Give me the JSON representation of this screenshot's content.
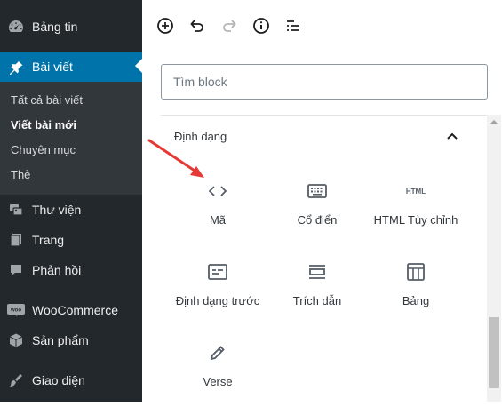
{
  "sidebar": {
    "items": [
      {
        "label": "Bảng tin",
        "icon": "dashboard-icon"
      },
      {
        "label": "Bài viết",
        "icon": "pushpin-icon"
      },
      {
        "label": "Thư viện",
        "icon": "media-icon"
      },
      {
        "label": "Trang",
        "icon": "pages-icon"
      },
      {
        "label": "Phản hồi",
        "icon": "comments-icon"
      },
      {
        "label": "WooCommerce",
        "icon": "woocommerce-icon"
      },
      {
        "label": "Sản phẩm",
        "icon": "products-icon"
      },
      {
        "label": "Giao diện",
        "icon": "appearance-icon"
      }
    ],
    "submenu": [
      {
        "label": "Tất cả bài viết"
      },
      {
        "label": "Viết bài mới"
      },
      {
        "label": "Chuyên mục"
      },
      {
        "label": "Thẻ"
      }
    ],
    "woo_badge": "woo"
  },
  "toolbar": {
    "buttons": [
      "add-block-icon",
      "undo-icon",
      "redo-icon",
      "info-icon",
      "outline-icon"
    ]
  },
  "search": {
    "placeholder": "Tìm block"
  },
  "section": {
    "title": "Định dạng"
  },
  "blocks": [
    {
      "label": "Mã",
      "icon": "code-icon"
    },
    {
      "label": "Cổ điển",
      "icon": "keyboard-icon"
    },
    {
      "label": "HTML Tùy chỉnh",
      "icon": "html-icon",
      "icon_text": "HTML"
    },
    {
      "label": "Định dạng trước",
      "icon": "preformatted-icon"
    },
    {
      "label": "Trích dẫn",
      "icon": "pullquote-icon"
    },
    {
      "label": "Bảng",
      "icon": "table-icon"
    },
    {
      "label": "Verse",
      "icon": "pencil-icon"
    }
  ],
  "colors": {
    "sidebar_bg": "#23282d",
    "submenu_bg": "#32373c",
    "active_bg": "#0073aa",
    "arrow": "#e53935"
  }
}
